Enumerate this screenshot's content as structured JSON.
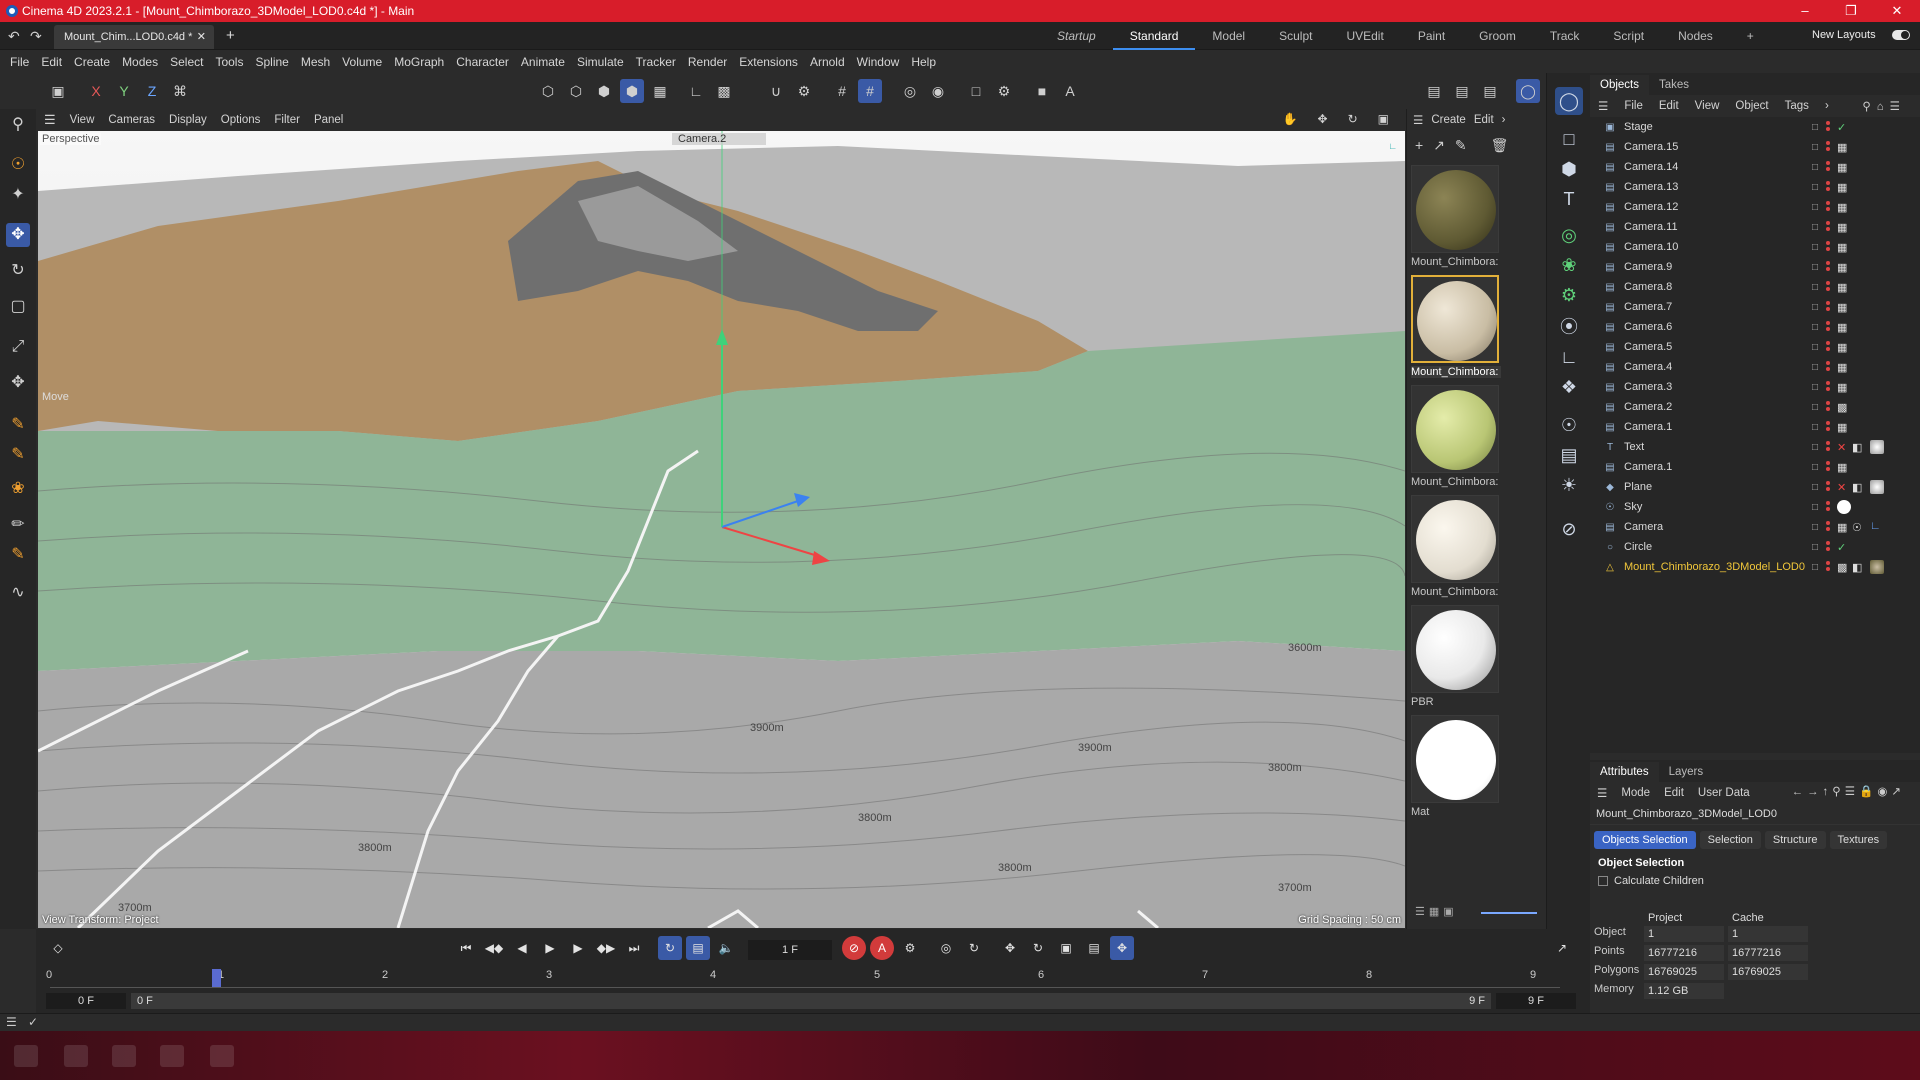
{
  "title_bar": {
    "title": "Cinema 4D 2023.2.1 - [Mount_Chimborazo_3DModel_LOD0.c4d *] - Main"
  },
  "doc_tab": {
    "label": "Mount_Chim...LOD0.c4d *"
  },
  "layouts": [
    "Startup",
    "Standard",
    "Model",
    "Sculpt",
    "UVEdit",
    "Paint",
    "Groom",
    "Track",
    "Script",
    "Nodes"
  ],
  "new_layouts": "New Layouts",
  "menu": [
    "File",
    "Edit",
    "Create",
    "Modes",
    "Select",
    "Tools",
    "Spline",
    "Mesh",
    "Volume",
    "MoGraph",
    "Character",
    "Animate",
    "Simulate",
    "Tracker",
    "Render",
    "Extensions",
    "Arnold",
    "Window",
    "Help"
  ],
  "viewport_menu": [
    "View",
    "Cameras",
    "Display",
    "Options",
    "Filter",
    "Panel"
  ],
  "viewport": {
    "label": "Perspective",
    "camera": "Camera.2",
    "move_label": "Move",
    "view_transform": "View Transform: Project",
    "grid_spacing": "Grid Spacing : 50 cm",
    "contours": [
      "3900m",
      "3800m",
      "3900m",
      "3800m",
      "3800m",
      "3800m",
      "3700m",
      "3700m",
      "3600m"
    ]
  },
  "material_menu": [
    "Create",
    "Edit"
  ],
  "materials": [
    {
      "name": "Mount_Chimbora:",
      "color": "#5f5a33"
    },
    {
      "name": "Mount_Chimbora:",
      "color": "#c9bda4",
      "selected": true
    },
    {
      "name": "Mount_Chimbora:",
      "color": "#b9c674"
    },
    {
      "name": "Mount_Chimbora:",
      "color": "#e3ddd0"
    },
    {
      "name": "PBR",
      "color": "#e9e9e9"
    },
    {
      "name": "Mat",
      "color": "#ffffff"
    }
  ],
  "objects_tabs": [
    "Objects",
    "Takes"
  ],
  "objects_menu": [
    "File",
    "Edit",
    "View",
    "Object",
    "Tags"
  ],
  "objects": [
    {
      "name": "Stage",
      "icon": "stage-icon"
    },
    {
      "name": "Camera.15"
    },
    {
      "name": "Camera.14"
    },
    {
      "name": "Camera.13"
    },
    {
      "name": "Camera.12"
    },
    {
      "name": "Camera.11"
    },
    {
      "name": "Camera.10"
    },
    {
      "name": "Camera.9"
    },
    {
      "name": "Camera.8"
    },
    {
      "name": "Camera.7"
    },
    {
      "name": "Camera.6"
    },
    {
      "name": "Camera.5"
    },
    {
      "name": "Camera.4"
    },
    {
      "name": "Camera.3"
    },
    {
      "name": "Camera.2"
    },
    {
      "name": "Camera.1"
    },
    {
      "name": "Text"
    },
    {
      "name": "Camera.1"
    },
    {
      "name": "Plane"
    },
    {
      "name": "Sky"
    },
    {
      "name": "Camera"
    },
    {
      "name": "Circle"
    },
    {
      "name": "Mount_Chimborazo_3DModel_LOD0"
    }
  ],
  "attributes_tabs": [
    "Attributes",
    "Layers"
  ],
  "attributes_menu": [
    "Mode",
    "Edit",
    "User Data"
  ],
  "attributes": {
    "object_name": "Mount_Chimborazo_3DModel_LOD0",
    "buttons": [
      "Objects Selection",
      "Selection",
      "Structure",
      "Textures"
    ],
    "section": "Object Selection",
    "calculate_children": "Calculate Children",
    "stats_headers": [
      "Project",
      "Cache"
    ],
    "stats": [
      {
        "key": "Object",
        "project": "1",
        "cache": "1"
      },
      {
        "key": "Points",
        "project": "16777216",
        "cache": "16777216"
      },
      {
        "key": "Polygons",
        "project": "16769025",
        "cache": "16769025"
      },
      {
        "key": "Memory",
        "project": "1.12 GB",
        "cache": ""
      }
    ]
  },
  "timeline": {
    "current_frame": "1 F",
    "ticks": [
      "0",
      "1",
      "2",
      "3",
      "4",
      "5",
      "6",
      "7",
      "8",
      "9"
    ],
    "start": "0 F",
    "range_start": "0 F",
    "range_end": "9 F",
    "end": "9 F"
  }
}
